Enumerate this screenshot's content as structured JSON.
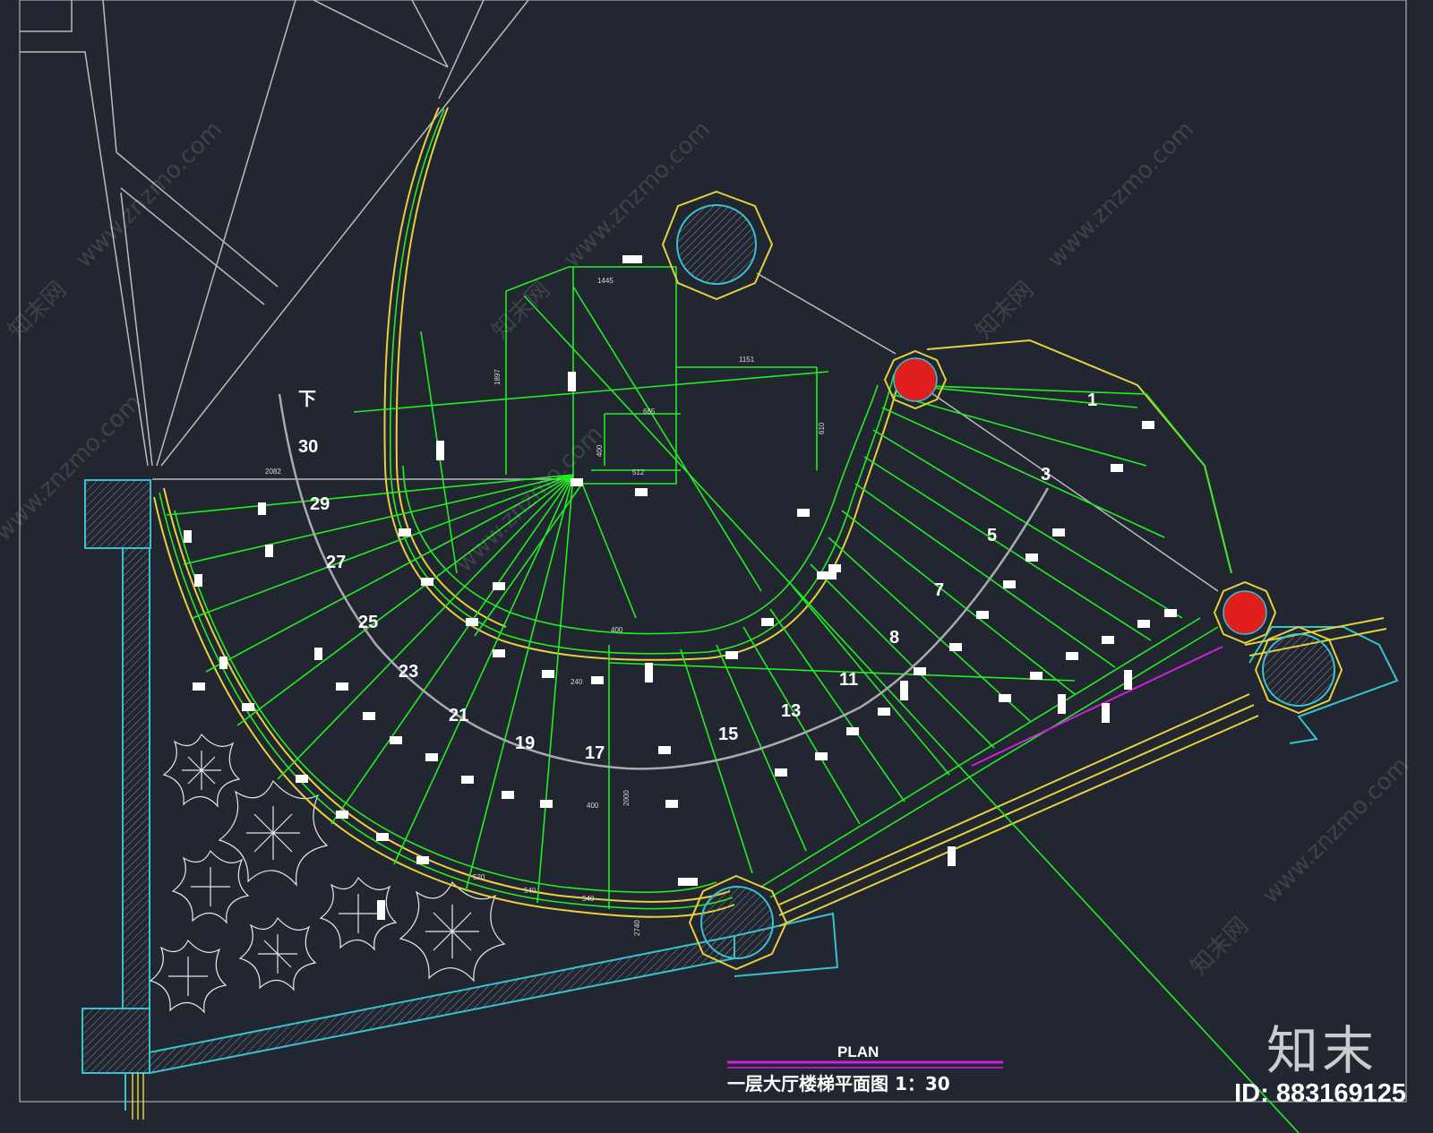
{
  "drawing": {
    "down_label": "下",
    "step_numbers": [
      "1",
      "3",
      "5",
      "7",
      "8",
      "11",
      "13",
      "15",
      "17",
      "19",
      "21",
      "23",
      "25",
      "27",
      "29",
      "30"
    ],
    "plan_label": "PLAN",
    "title": "一层大厅楼梯平面图 1：30",
    "dimensions": {
      "top_width": "1445",
      "right_width": "1151",
      "left_height": "1897",
      "inner_width": "665",
      "bottom_width": "512",
      "inner_height": "400",
      "right_height": "610",
      "left_span": "2082",
      "inner_radius": "400",
      "mid_radius": "400",
      "outer_tread_1": "540",
      "outer_tread_2": "540",
      "inner_tread": "240",
      "outer_tread_3": "520",
      "vertical_center": "2000",
      "vertical_lower": "2740"
    },
    "colors": {
      "background": "#212631",
      "stair_lines": "#22ee22",
      "outline": "#e6d23a",
      "walls": "#36c3d0",
      "construction": "#cfcfcf",
      "columns_fill": "#e01e1e",
      "title_underline": "#d21ee0"
    }
  },
  "watermark": {
    "site": "www.znzmo.com",
    "brand_cn": "知末网",
    "brand_corner": "知末"
  },
  "image_id": "ID: 883169125"
}
